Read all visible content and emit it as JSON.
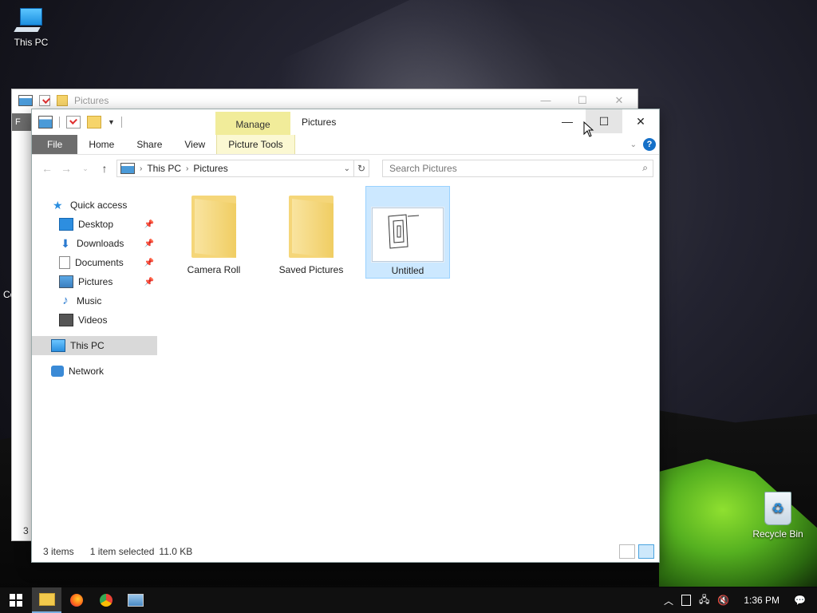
{
  "desktop": {
    "icons": [
      {
        "label": "This PC"
      },
      {
        "label": "Recycle Bin"
      }
    ]
  },
  "back_window": {
    "title": "Pictures",
    "partial_tab": "F",
    "partial_status": "3 i",
    "partial_label": "Co"
  },
  "window": {
    "title": "Pictures",
    "contextual_tab": "Manage",
    "ribbon_tabs": [
      "File",
      "Home",
      "Share",
      "View",
      "Picture Tools"
    ],
    "address": {
      "crumbs": [
        "This PC",
        "Pictures"
      ]
    },
    "search": {
      "placeholder": "Search Pictures"
    },
    "nav_pane": {
      "quick_access": "Quick access",
      "items": [
        "Desktop",
        "Downloads",
        "Documents",
        "Pictures",
        "Music",
        "Videos"
      ],
      "this_pc": "This PC",
      "network": "Network"
    },
    "files": [
      {
        "name": "Camera Roll",
        "type": "folder"
      },
      {
        "name": "Saved Pictures",
        "type": "folder"
      },
      {
        "name": "Untitled",
        "type": "image",
        "selected": true
      }
    ],
    "status": {
      "count": "3 items",
      "selection": "1 item selected",
      "size": "11.0 KB"
    }
  },
  "taskbar": {
    "clock": "1:36 PM"
  }
}
